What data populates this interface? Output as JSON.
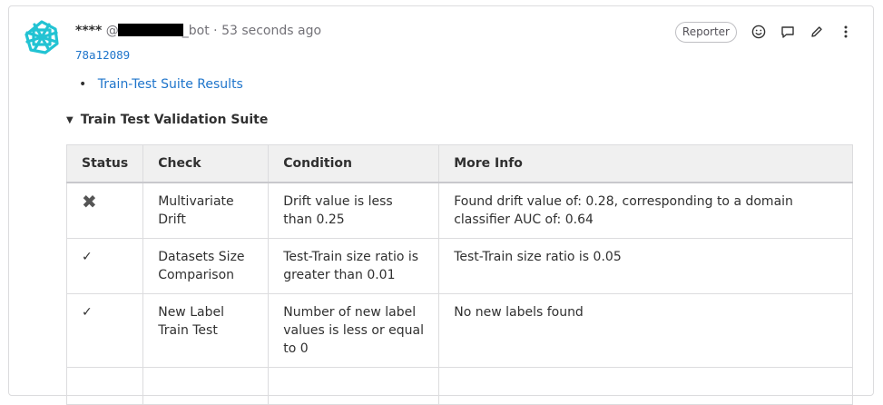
{
  "note": {
    "author": "****",
    "handle_prefix": "@",
    "handle_suffix": "_bot",
    "separator": "·",
    "timestamp": "53 seconds ago",
    "commit": "78a12089",
    "role_badge": "Reporter"
  },
  "icons": {
    "avatar": "identicon-avatar",
    "emoji": "smiley-icon",
    "reply": "comment-icon",
    "edit": "pencil-icon",
    "more": "kebab-menu-icon"
  },
  "colors": {
    "link": "#1f75cb",
    "avatar": "#22c3d3"
  },
  "results_link": "Train-Test Suite Results",
  "suite": {
    "title": "Train Test Validation Suite",
    "headers": [
      "Status",
      "Check",
      "Condition",
      "More Info"
    ],
    "rows": [
      {
        "status": "✖",
        "check": "Multivariate Drift",
        "condition": "Drift value is less than 0.25",
        "info": "Found drift value of: 0.28, corresponding to a domain classifier AUC of: 0.64"
      },
      {
        "status": "✓",
        "check": "Datasets Size Comparison",
        "condition": "Test-Train size ratio is greater than 0.01",
        "info": "Test-Train size ratio is 0.05"
      },
      {
        "status": "✓",
        "check": "New Label Train Test",
        "condition": "Number of new label values is less or equal to 0",
        "info": "No new labels found"
      }
    ]
  }
}
